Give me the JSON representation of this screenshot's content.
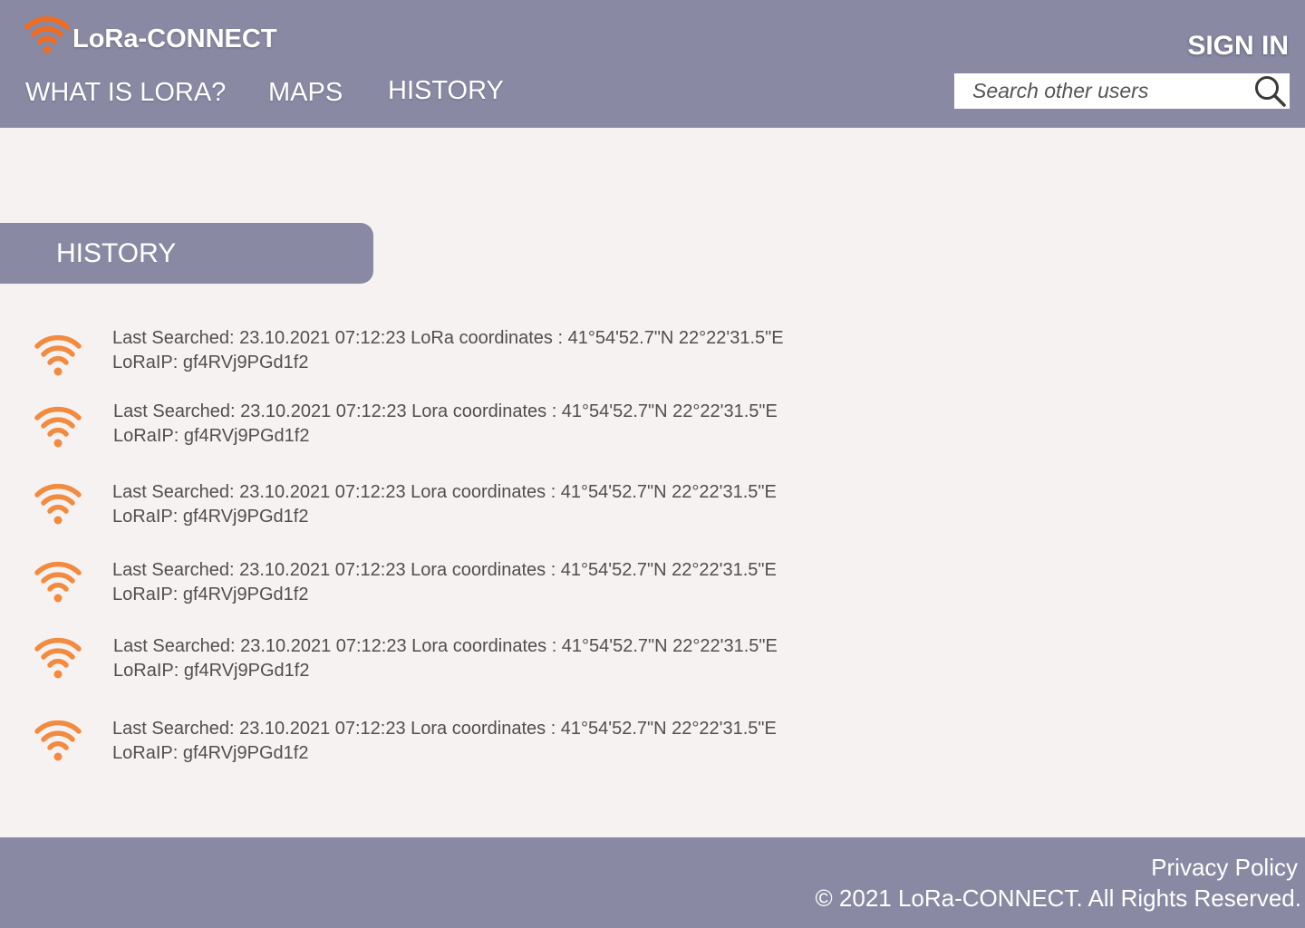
{
  "header": {
    "brand": "LoRa-CONNECT",
    "brand_icon": "wifi-icon",
    "nav": [
      {
        "label": "WHAT IS LORA?"
      },
      {
        "label": "MAPS"
      },
      {
        "label": "HISTORY"
      }
    ],
    "sign_in": "SIGN IN",
    "search": {
      "placeholder": "Search other users",
      "icon": "search-icon"
    }
  },
  "main": {
    "section_title": "HISTORY",
    "items": [
      {
        "line1": "Last Searched: 23.10.2021 07:12:23  LoRa coordinates : 41°54'52.7\"N 22°22'31.5\"E",
        "line2": "LoRaIP: gf4RVj9PGd1f2"
      },
      {
        "line1": "Last Searched: 23.10.2021 07:12:23  Lora coordinates : 41°54'52.7\"N 22°22'31.5\"E",
        "line2": "LoRaIP: gf4RVj9PGd1f2"
      },
      {
        "line1": "Last Searched: 23.10.2021 07:12:23  Lora coordinates : 41°54'52.7\"N 22°22'31.5\"E",
        "line2": "LoRaIP: gf4RVj9PGd1f2"
      },
      {
        "line1": "Last Searched: 23.10.2021 07:12:23  Lora coordinates : 41°54'52.7\"N 22°22'31.5\"E",
        "line2": "LoRaIP: gf4RVj9PGd1f2"
      },
      {
        "line1": "Last Searched: 23.10.2021 07:12:23  Lora coordinates : 41°54'52.7\"N 22°22'31.5\"E",
        "line2": "LoRaIP: gf4RVj9PGd1f2"
      },
      {
        "line1": "Last Searched: 23.10.2021 07:12:23  Lora coordinates : 41°54'52.7\"N 22°22'31.5\"E",
        "line2": "LoRaIP: gf4RVj9PGd1f2"
      }
    ]
  },
  "footer": {
    "privacy": "Privacy Policy",
    "copyright": "© 2021 LoRa-CONNECT. All Rights Reserved."
  },
  "colors": {
    "header_bg": "#8a89a4",
    "page_bg": "#f6f2f1",
    "accent_orange": "#f28a3f",
    "brand_orange": "#f26c1e"
  }
}
